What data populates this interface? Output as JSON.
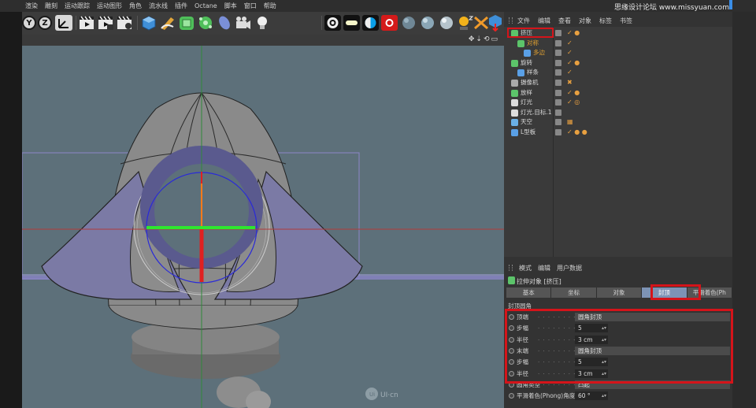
{
  "menubar": [
    "渲染",
    "雕刻",
    "运动跟踪",
    "运动图形",
    "角色",
    "流水线",
    "插件",
    "Octane",
    "脚本",
    "窗口",
    "帮助"
  ],
  "toolbar": {
    "axis_buttons": [
      "Y",
      "Z"
    ],
    "icons": [
      "coordinate-system-icon",
      "render-view-icon",
      "render-picture-viewer-icon",
      "edit-render-settings-icon",
      "cube-icon",
      "pen-icon",
      "subdivision-icon",
      "array-icon",
      "deformer-icon",
      "camera-icon",
      "light-icon"
    ],
    "right_icons": [
      "render-target-icon",
      "light-strip-icon",
      "half-circle-icon",
      "record-icon",
      "sphere-dark-icon",
      "sphere-mid-icon",
      "sphere-light-icon",
      "sun-icon",
      "scatter-icon",
      "cube-move-icon"
    ]
  },
  "watermark": "思缘设计论坛 www.missyuan.com",
  "object_manager": {
    "menu": [
      "文件",
      "编辑",
      "查看",
      "对象",
      "标签",
      "书签"
    ],
    "rows": [
      {
        "name": "挤压",
        "indent": 0,
        "color": "#5cc46a",
        "name_color": "#d9d9d9",
        "tags": "✓ ●"
      },
      {
        "name": "对称",
        "indent": 1,
        "color": "#5cc46a",
        "name_color": "#e0a030",
        "tags": "✓"
      },
      {
        "name": "多边",
        "indent": 2,
        "color": "#5aa0e6",
        "name_color": "#e0a030",
        "tags": "✓"
      },
      {
        "name": "旋转",
        "indent": 0,
        "color": "#5cc46a",
        "name_color": "#d9d9d9",
        "tags": "✓ ●"
      },
      {
        "name": "样条",
        "indent": 1,
        "color": "#5aa0e6",
        "name_color": "#d9d9d9",
        "tags": "✓"
      },
      {
        "name": "摄像机",
        "indent": 0,
        "color": "#aaaaaa",
        "name_color": "#d9d9d9",
        "tags": "✖"
      },
      {
        "name": "放样",
        "indent": 0,
        "color": "#5cc46a",
        "name_color": "#d9d9d9",
        "tags": "✓ ●"
      },
      {
        "name": "灯光",
        "indent": 0,
        "color": "#dddddd",
        "name_color": "#d9d9d9",
        "tags": "✓ ◎"
      },
      {
        "name": "灯光.目标.1",
        "indent": 0,
        "color": "#dddddd",
        "name_color": "#d9d9d9",
        "tags": ""
      },
      {
        "name": "天空",
        "indent": 0,
        "color": "#6ab0e6",
        "name_color": "#d9d9d9",
        "tags": "▦"
      },
      {
        "name": "L型板",
        "indent": 0,
        "color": "#5aa0e6",
        "name_color": "#d9d9d9",
        "tags": "✓ ● ●"
      }
    ]
  },
  "attributes": {
    "menu": [
      "模式",
      "编辑",
      "用户数据"
    ],
    "title": "拉伸对象 [挤压]",
    "tabs": [
      "基本",
      "坐标",
      "对象",
      "封顶",
      "平滑着色(Ph"
    ],
    "active_tab": "封顶",
    "section": "封顶圆角",
    "params": [
      {
        "label": "顶端",
        "value": "圆角封顶",
        "kind": "sel"
      },
      {
        "label": "步幅",
        "value": "5",
        "kind": "num"
      },
      {
        "label": "半径",
        "value": "3 cm",
        "kind": "num"
      },
      {
        "label": "末端",
        "value": "圆角封顶",
        "kind": "sel"
      },
      {
        "label": "步幅",
        "value": "5",
        "kind": "num"
      },
      {
        "label": "半径",
        "value": "3 cm",
        "kind": "num"
      },
      {
        "label": "圆角类型",
        "value": "凸起",
        "kind": "sel"
      },
      {
        "label": "平滑着色(Phong)角度",
        "value": "60 °",
        "kind": "num"
      }
    ]
  },
  "viewport_watermark": "UI·cn",
  "colors": {
    "highlight": "#d4141a",
    "viewport": "#5d707a",
    "active_tab": "#7d93b5"
  }
}
